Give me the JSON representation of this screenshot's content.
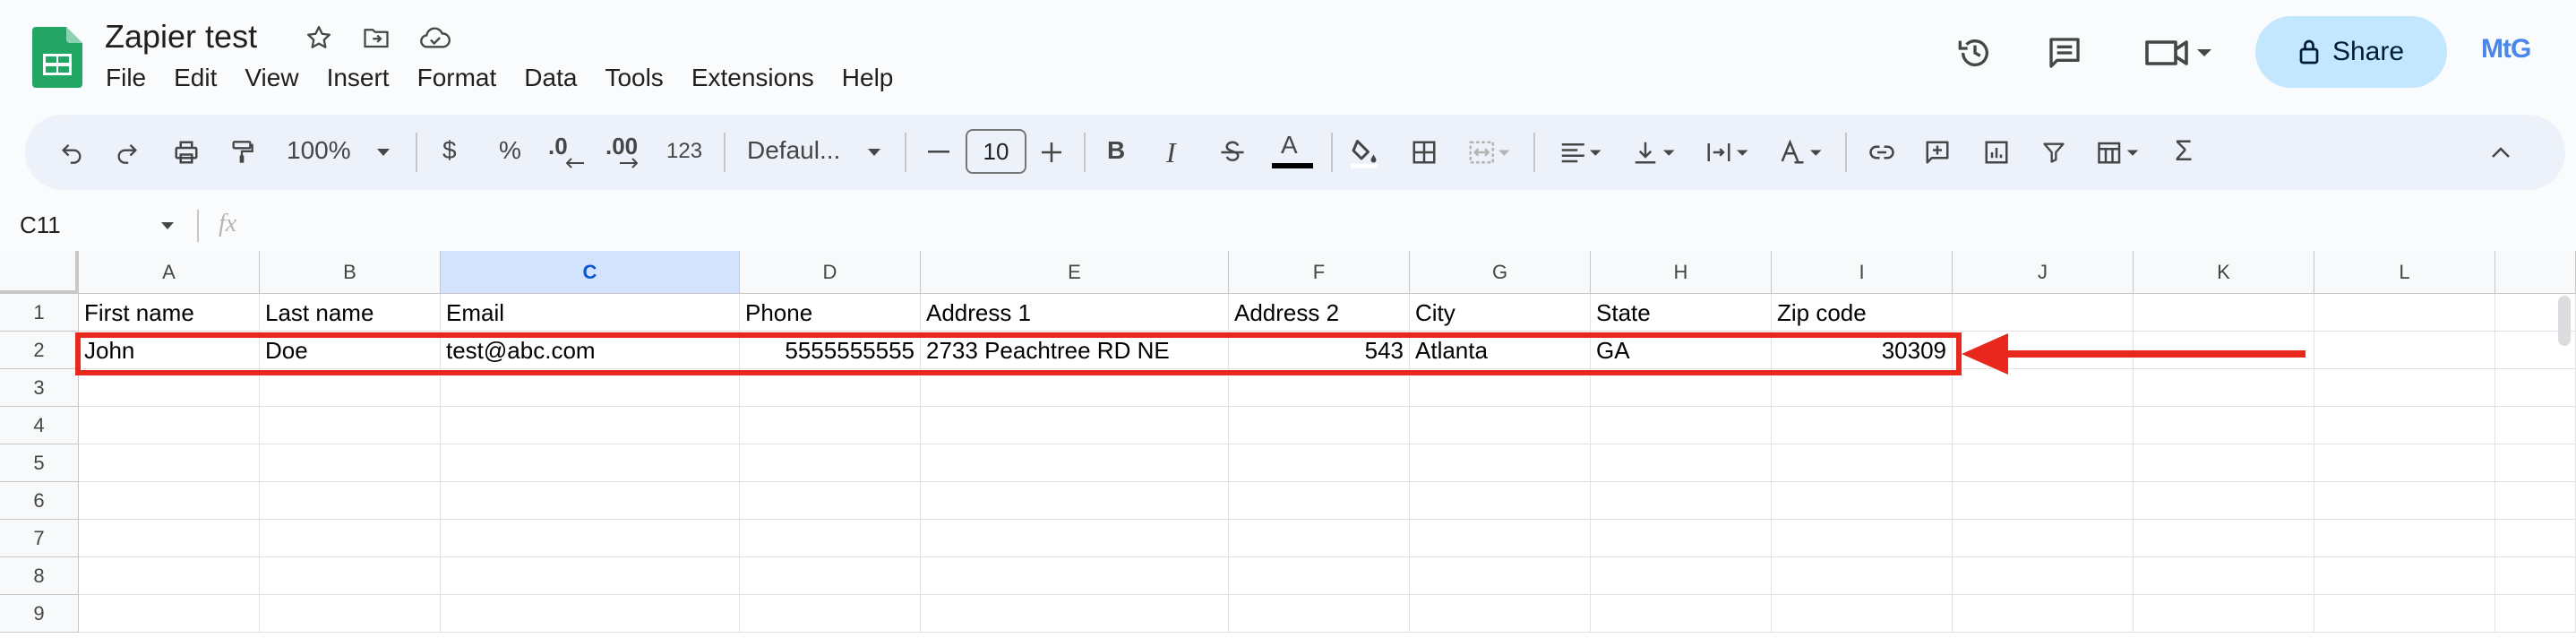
{
  "app": {
    "doc_title": "Zapier test",
    "menu": [
      "File",
      "Edit",
      "View",
      "Insert",
      "Format",
      "Data",
      "Tools",
      "Extensions",
      "Help"
    ],
    "share_label": "Share",
    "avatar_text": "MtG",
    "accent": "#0b57d0",
    "logo_color": "#23a566"
  },
  "toolbar": {
    "zoom": "100%",
    "currency": "$",
    "percent": "%",
    "dec_decrease": ".0",
    "dec_increase": ".00",
    "number_format": "123",
    "font": "Defaul...",
    "font_size": "10",
    "bold": "B",
    "italic": "I",
    "text_color_glyph": "A",
    "sum_glyph": "Σ"
  },
  "formula_bar": {
    "cell_ref": "C11",
    "fx": "fx",
    "value": ""
  },
  "sheet": {
    "columns": [
      "A",
      "B",
      "C",
      "D",
      "E",
      "F",
      "G",
      "H",
      "I",
      "J",
      "K",
      "L"
    ],
    "selected_column": "C",
    "row_numbers": [
      "1",
      "2",
      "3",
      "4",
      "5",
      "6",
      "7",
      "8",
      "9"
    ],
    "rows": [
      [
        "First name",
        "Last name",
        "Email",
        "Phone",
        "Address 1",
        "Address 2",
        "City",
        "State",
        "Zip code",
        "",
        "",
        ""
      ],
      [
        "John",
        "Doe",
        "test@abc.com",
        "5555555555",
        "2733 Peachtree RD NE",
        "543",
        "Atlanta",
        "GA",
        "30309",
        "",
        "",
        ""
      ]
    ],
    "numeric_cells_row2": [
      3,
      5,
      8
    ]
  },
  "annotation": {
    "highlight_color": "#e8281c",
    "highlighted_row": "2"
  }
}
